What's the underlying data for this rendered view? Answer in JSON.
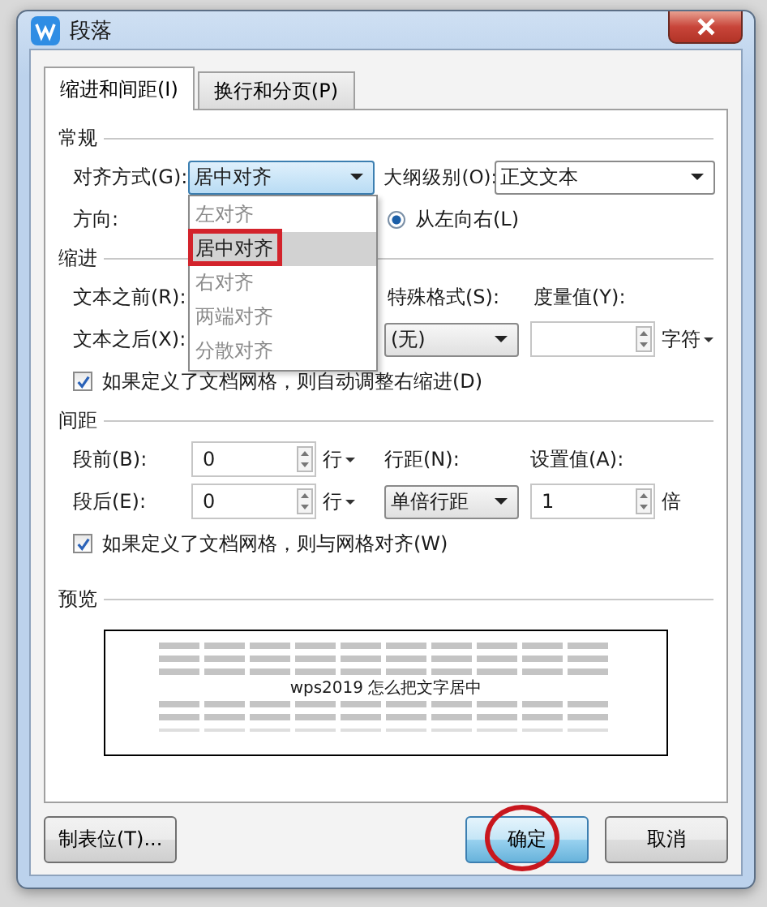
{
  "window": {
    "title": "段落"
  },
  "tabs": [
    {
      "label": "缩进和间距(I)",
      "selected": true
    },
    {
      "label": "换行和分页(P)",
      "selected": false
    }
  ],
  "general": {
    "heading": "常规",
    "alignment": {
      "label": "对齐方式(G):",
      "value": "居中对齐",
      "options": [
        {
          "label": "左对齐",
          "selected": false,
          "annotated": false
        },
        {
          "label": "居中对齐",
          "selected": true,
          "annotated": true
        },
        {
          "label": "右对齐",
          "selected": false,
          "annotated": false
        },
        {
          "label": "两端对齐",
          "selected": false,
          "annotated": false
        },
        {
          "label": "分散对齐",
          "selected": false,
          "annotated": false
        }
      ]
    },
    "outline": {
      "label": "大纲级别(O):",
      "value": "正文文本"
    },
    "direction": {
      "label": "方向:",
      "options": [
        {
          "label": "从左向右(L)",
          "selected": true
        }
      ]
    }
  },
  "indent": {
    "heading": "缩进",
    "before": {
      "label": "文本之前(R):"
    },
    "after": {
      "label": "文本之后(X):"
    },
    "special": {
      "label": "特殊格式(S):",
      "value": "(无)"
    },
    "measure": {
      "label": "度量值(Y):",
      "unit": "字符"
    },
    "auto_adjust": {
      "label": "如果定义了文档网格，则自动调整右缩进(D)",
      "checked": true
    }
  },
  "spacing": {
    "heading": "间距",
    "before": {
      "label": "段前(B):",
      "value": "0",
      "unit": "行"
    },
    "after": {
      "label": "段后(E):",
      "value": "0",
      "unit": "行"
    },
    "line_spacing": {
      "label": "行距(N):",
      "value": "单倍行距"
    },
    "setting": {
      "label": "设置值(A):",
      "value": "1",
      "unit": "倍"
    },
    "snap": {
      "label": "如果定义了文档网格，则与网格对齐(W)",
      "checked": true
    }
  },
  "preview": {
    "heading": "预览",
    "sample": "wps2019 怎么把文字居中"
  },
  "buttons": [
    {
      "label": "制表位(T)...",
      "kind": "normal",
      "annotated": false
    },
    {
      "label": "确定",
      "kind": "default",
      "annotated": true
    },
    {
      "label": "取消",
      "kind": "normal",
      "annotated": false
    }
  ]
}
